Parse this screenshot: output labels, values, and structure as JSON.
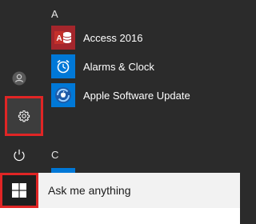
{
  "start_menu": {
    "rail": {
      "user_icon": "user-icon",
      "settings_icon": "gear-icon",
      "power_icon": "power-icon"
    },
    "sections": [
      {
        "letter": "A",
        "apps": [
          {
            "label": "Access 2016",
            "icon": "access-icon",
            "tile_color": "#a4262c"
          },
          {
            "label": "Alarms & Clock",
            "icon": "alarm-clock-icon",
            "tile_color": "#0078d7"
          },
          {
            "label": "Apple Software Update",
            "icon": "apple-update-icon",
            "tile_color": "#0078d7"
          }
        ]
      },
      {
        "letter": "C",
        "apps": []
      }
    ]
  },
  "taskbar": {
    "start_icon": "windows-logo-icon",
    "search_text": "Ask me anything"
  },
  "colors": {
    "menu_bg": "#2b2b2b",
    "highlight": "#e02525",
    "accent": "#0078d7"
  }
}
